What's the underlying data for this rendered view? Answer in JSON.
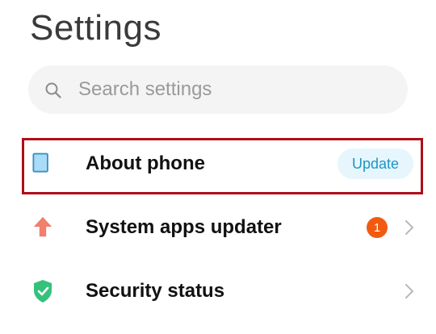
{
  "header": {
    "title": "Settings"
  },
  "search": {
    "placeholder": "Search settings",
    "icon": "search-icon"
  },
  "items": [
    {
      "label": "About phone",
      "icon": "phone-icon",
      "action": "Update",
      "highlighted": true
    },
    {
      "label": "System apps updater",
      "icon": "arrow-up-icon",
      "badge": "1",
      "icon_color": "#f07f6d"
    },
    {
      "label": "Security status",
      "icon": "shield-check-icon",
      "icon_color": "#34c27a"
    }
  ],
  "colors": {
    "highlight_border": "#b00d1a",
    "update_text": "#1e95c6",
    "update_bg": "#e6f6fc",
    "badge_bg": "#f25a10"
  }
}
